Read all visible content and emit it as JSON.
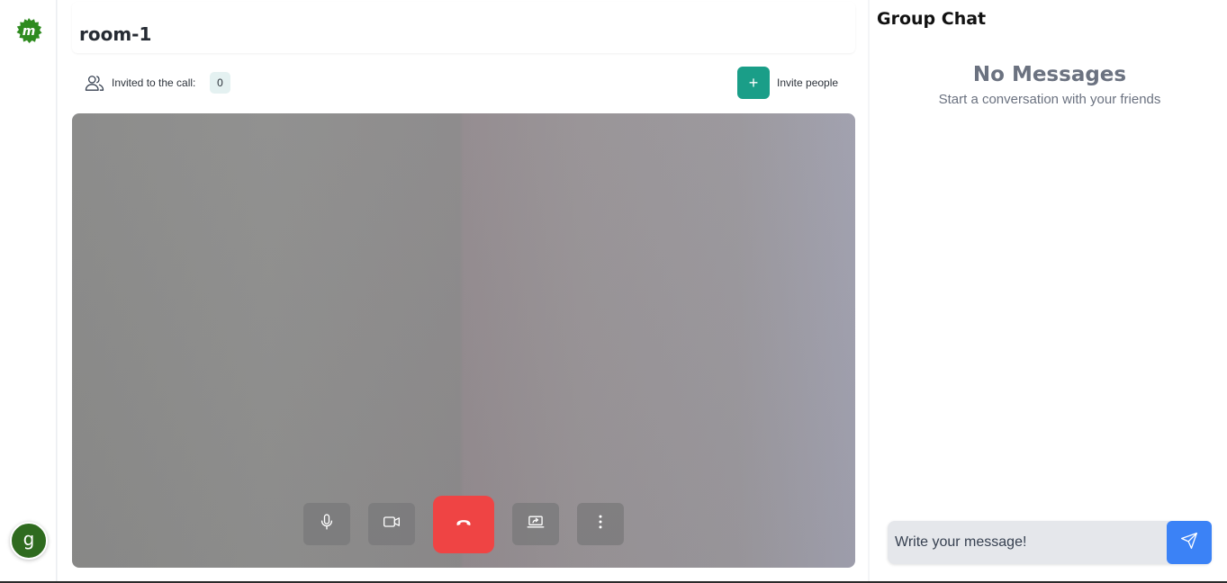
{
  "room": {
    "title": "room-1"
  },
  "invite": {
    "label": "Invited to the call:",
    "count": "0",
    "button_icon": "+",
    "button_label": "Invite people"
  },
  "user": {
    "avatar_initial": "g",
    "avatar_color": "#2f6b1f"
  },
  "controls": {
    "items": [
      "microphone-icon",
      "camera-icon",
      "end-call-icon",
      "share-screen-icon",
      "more-options-icon"
    ]
  },
  "chat": {
    "title": "Group Chat",
    "empty_title": "No Messages",
    "empty_subtitle": "Start a conversation with your friends",
    "input_placeholder": "Write your message!"
  },
  "colors": {
    "accent": "#1a9e88",
    "end_call": "#ef4444",
    "send": "#3b82f6",
    "logo": "#2e8b1f"
  }
}
